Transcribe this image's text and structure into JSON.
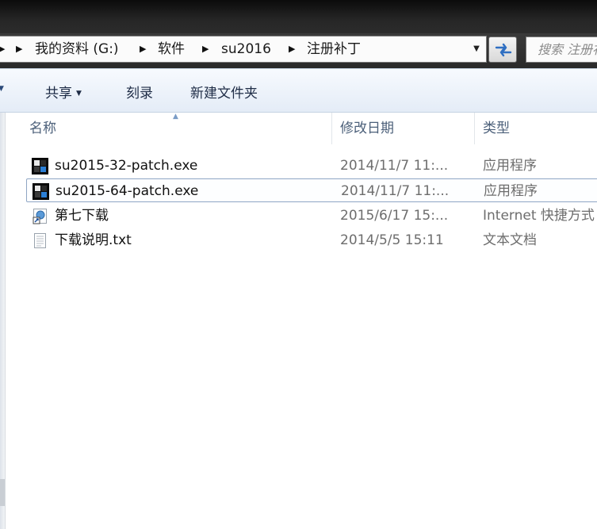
{
  "breadcrumb": {
    "items": [
      "我的资料 (G:)",
      "软件",
      "su2016",
      "注册补丁"
    ]
  },
  "search": {
    "placeholder": "搜索 注册补丁"
  },
  "toolbar": {
    "share_label": "共享",
    "burn_label": "刻录",
    "new_folder_label": "新建文件夹"
  },
  "columns": {
    "name": "名称",
    "date_modified": "修改日期",
    "type": "类型"
  },
  "files": [
    {
      "name": "su2015-32-patch.exe",
      "date": "2014/11/7 11:...",
      "type": "应用程序",
      "icon": "exe-icon"
    },
    {
      "name": "su2015-64-patch.exe",
      "date": "2014/11/7 11:...",
      "type": "应用程序",
      "icon": "exe-icon",
      "selected": true
    },
    {
      "name": "第七下载",
      "date": "2015/6/17 15:...",
      "type": "Internet 快捷方式",
      "icon": "internet-shortcut-icon"
    },
    {
      "name": "下载说明.txt",
      "date": "2014/5/5 15:11",
      "type": "文本文档",
      "icon": "text-document-icon"
    }
  ]
}
